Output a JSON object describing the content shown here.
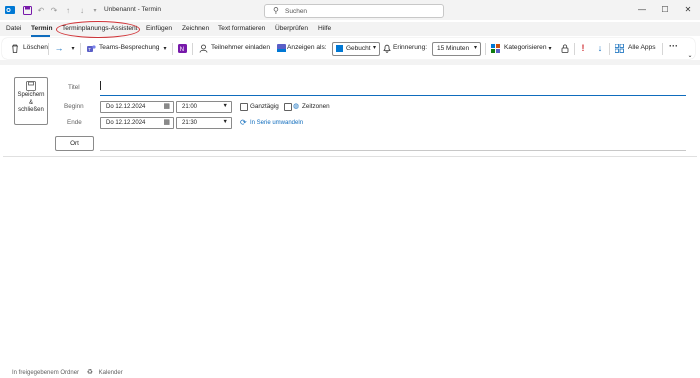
{
  "window": {
    "title": "Unbenannt - Termin",
    "search_placeholder": "Suchen"
  },
  "menu": {
    "items": [
      "Datei",
      "Termin",
      "Terminplanungs-Assistent",
      "Einfügen",
      "Zeichnen",
      "Text formatieren",
      "Überprüfen",
      "Hilfe"
    ],
    "active": "Termin",
    "highlighted": "Terminplanungs-Assistent"
  },
  "ribbon": {
    "delete_label": "Löschen",
    "teams_label": "Teams-Besprechung",
    "invite_label": "Teilnehmer einladen",
    "show_as_label": "Anzeigen als:",
    "show_as_value": "Gebucht",
    "reminder_label": "Erinnerung:",
    "reminder_value": "15 Minuten",
    "categorize_label": "Kategorisieren",
    "all_apps_label": "Alle Apps",
    "more_label": "···"
  },
  "form": {
    "save_label_line1": "Speichern",
    "save_label_line2": "&",
    "save_label_line3": "schließen",
    "title_label": "Titel",
    "title_value": "",
    "start_label": "Beginn",
    "start_date": "Do 12.12.2024",
    "start_time": "21:00",
    "end_label": "Ende",
    "end_date": "Do 12.12.2024",
    "end_time": "21:30",
    "all_day_label": "Ganztägig",
    "timezones_label": "Zeitzonen",
    "recurrence_link": "In Serie umwandeln",
    "location_button": "Ort",
    "location_value": ""
  },
  "status": {
    "folder_text": "In freigegebenem Ordner",
    "calendar_text": "Kalender"
  },
  "colors": {
    "accent": "#0f6cbd",
    "highlight_circle": "#d13438",
    "outlook_blue": "#0078d4",
    "teams_purple": "#5b5fc7",
    "onenote_purple": "#7719aa",
    "red_flag": "#d13438"
  }
}
